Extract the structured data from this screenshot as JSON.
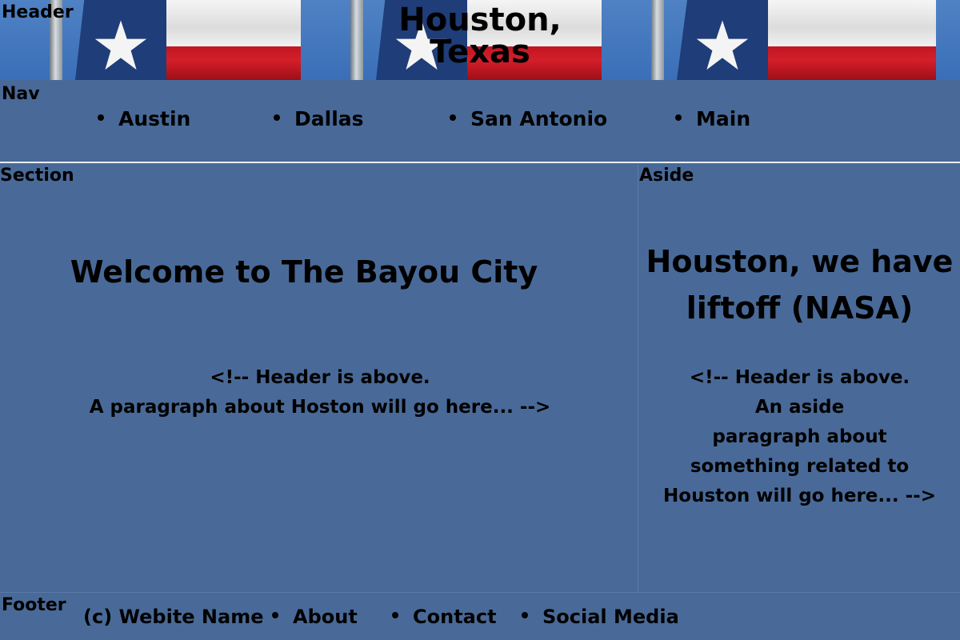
{
  "header": {
    "label": "Header",
    "title_line1": "Houston,",
    "title_line2": "Texas",
    "flag_image": "texas-flag-icon"
  },
  "nav": {
    "label": "Nav",
    "items": [
      {
        "label": "Austin"
      },
      {
        "label": "Dallas"
      },
      {
        "label": "San Antonio"
      },
      {
        "label": "Main"
      }
    ]
  },
  "section": {
    "label": "Section",
    "title": "Welcome to The Bayou City",
    "paragraph": [
      "<!-- Header is above.",
      "A paragraph about Hoston will go here... -->"
    ]
  },
  "aside": {
    "label": "Aside",
    "title_lines": [
      "Houston, we have",
      "liftoff (NASA)"
    ],
    "paragraph": [
      "<!-- Header is above.",
      "An aside",
      "paragraph about",
      "something related to",
      "Houston will go here... -->"
    ]
  },
  "footer": {
    "label": "Footer",
    "site_name": "(c) Webite Name",
    "links": [
      {
        "label": "About"
      },
      {
        "label": "Contact"
      },
      {
        "label": "Social Media"
      }
    ]
  },
  "colors": {
    "background": "#496a98",
    "flag_blue": "#1f3d78",
    "flag_red": "#c01622",
    "flag_white": "#f5f5f5",
    "divider": "#e9eef5"
  }
}
